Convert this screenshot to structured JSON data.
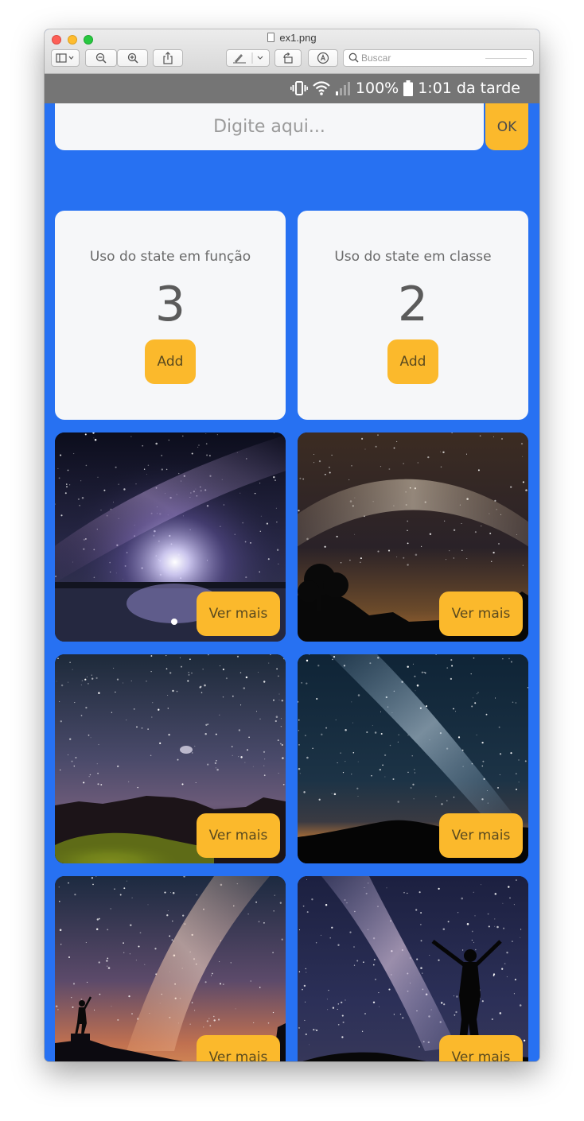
{
  "window": {
    "title": "ex1.png"
  },
  "toolbar": {
    "search_placeholder": "Buscar",
    "icons": [
      "sidebar-toggle-icon",
      "zoom-out-icon",
      "zoom-in-icon",
      "share-icon",
      "markup-pen-icon",
      "rotate-icon",
      "annotate-icon",
      "search-icon"
    ]
  },
  "status": {
    "battery": "100%",
    "time": "1:01 da tarde",
    "icons": [
      "vibrate-icon",
      "wifi-icon",
      "signal-icon",
      "battery-icon"
    ]
  },
  "input": {
    "placeholder": "Digite aqui...",
    "value": ""
  },
  "ok_button": {
    "label": "OK"
  },
  "counters": [
    {
      "title": "Uso do state em função",
      "count": "3",
      "button": "Add"
    },
    {
      "title": "Uso do state em classe",
      "count": "2",
      "button": "Add"
    }
  ],
  "gallery": {
    "button_label": "Ver mais",
    "photos": [
      {
        "name": "milky-way-lake-reflection"
      },
      {
        "name": "milky-way-tree-silhouette"
      },
      {
        "name": "starry-sky-canyon"
      },
      {
        "name": "milky-way-horizon-glow"
      },
      {
        "name": "milky-way-person-pointing"
      },
      {
        "name": "milky-way-person-arms-up"
      }
    ]
  },
  "colors": {
    "background": "#2771f2",
    "accent": "#fbb92c",
    "card": "#f6f7f9",
    "statusbar": "#757575"
  }
}
